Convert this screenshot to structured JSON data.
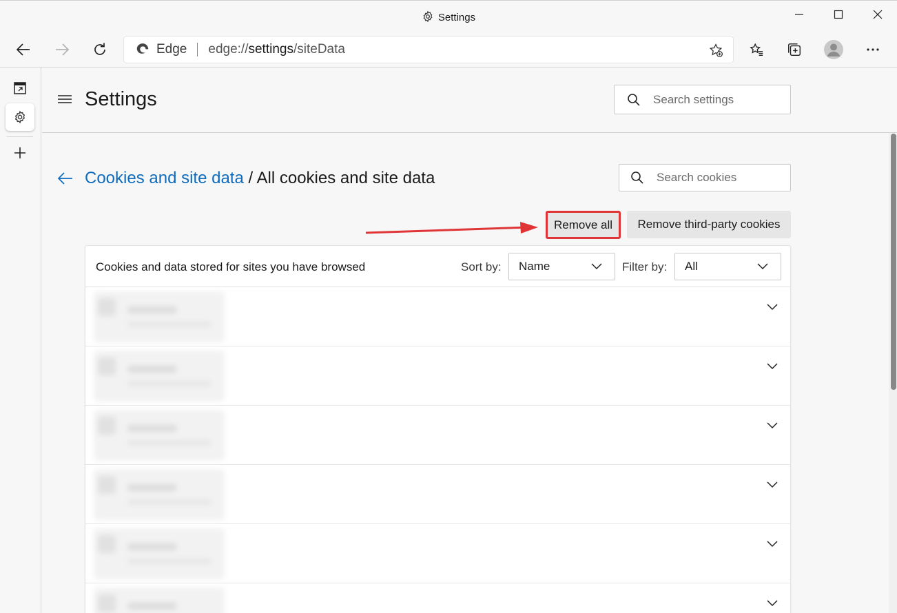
{
  "window": {
    "title": "Settings"
  },
  "address_bar": {
    "brand": "Edge",
    "url_prefix": "edge://",
    "url_host": "settings",
    "url_path": "/siteData"
  },
  "settings": {
    "title": "Settings",
    "search_placeholder": "Search settings"
  },
  "page": {
    "breadcrumb_link": "Cookies and site data",
    "breadcrumb_sep": " / ",
    "breadcrumb_current": "All cookies and site data",
    "search_cookies_placeholder": "Search cookies",
    "remove_all_label": "Remove all",
    "remove_third_party_label": "Remove third-party cookies"
  },
  "card": {
    "description": "Cookies and data stored for sites you have browsed",
    "sort_label": "Sort by:",
    "sort_value": "Name",
    "filter_label": "Filter by:",
    "filter_value": "All"
  },
  "colors": {
    "accent_link": "#0f6cbd",
    "annotation_red": "#e03537"
  }
}
